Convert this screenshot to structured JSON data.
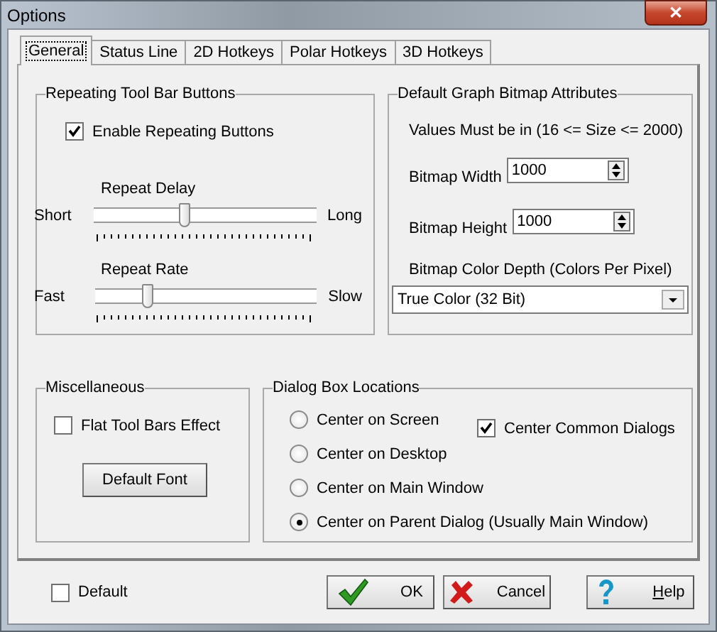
{
  "window": {
    "title": "Options",
    "close": "✕"
  },
  "tabs": [
    {
      "label": "General",
      "selected": true
    },
    {
      "label": "Status Line",
      "selected": false
    },
    {
      "label": "2D Hotkeys",
      "selected": false
    },
    {
      "label": "Polar Hotkeys",
      "selected": false
    },
    {
      "label": "3D Hotkeys",
      "selected": false
    }
  ],
  "repeating": {
    "title": "Repeating Tool Bar Buttons",
    "enable": {
      "label": "Enable Repeating Buttons",
      "checked": true
    },
    "sliders": [
      {
        "title": "Repeat Delay",
        "min_label": "Short",
        "max_label": "Long",
        "level": 0.41
      },
      {
        "title": "Repeat Rate",
        "min_label": "Fast",
        "max_label": "Slow",
        "level": 0.24
      }
    ]
  },
  "bitmap": {
    "title": "Default Graph Bitmap Attributes",
    "note": "Values Must be in (16 <= Size <= 2000)",
    "fields": [
      {
        "label": "Bitmap Width",
        "value": "1000"
      },
      {
        "label": "Bitmap Height",
        "value": "1000"
      }
    ],
    "depth_label": "Bitmap Color Depth (Colors Per Pixel)",
    "depth_value": "True Color (32 Bit)"
  },
  "misc": {
    "title": "Miscellaneous",
    "flat": {
      "label": "Flat Tool Bars Effect",
      "checked": false
    },
    "font_button": "Default Font"
  },
  "locations": {
    "title": "Dialog Box Locations",
    "options": [
      {
        "label": "Center on Screen",
        "selected": false
      },
      {
        "label": "Center on Desktop",
        "selected": false
      },
      {
        "label": "Center on Main Window",
        "selected": false
      },
      {
        "label": "Center on Parent Dialog (Usually Main Window)",
        "selected": true
      }
    ],
    "common": {
      "label": "Center Common Dialogs",
      "checked": true
    }
  },
  "default": {
    "label": "Default",
    "checked": false
  },
  "buttons": [
    {
      "kind": "ok",
      "label": "OK"
    },
    {
      "kind": "cancel",
      "label": "Cancel"
    },
    {
      "kind": "help",
      "label": "Help"
    }
  ]
}
